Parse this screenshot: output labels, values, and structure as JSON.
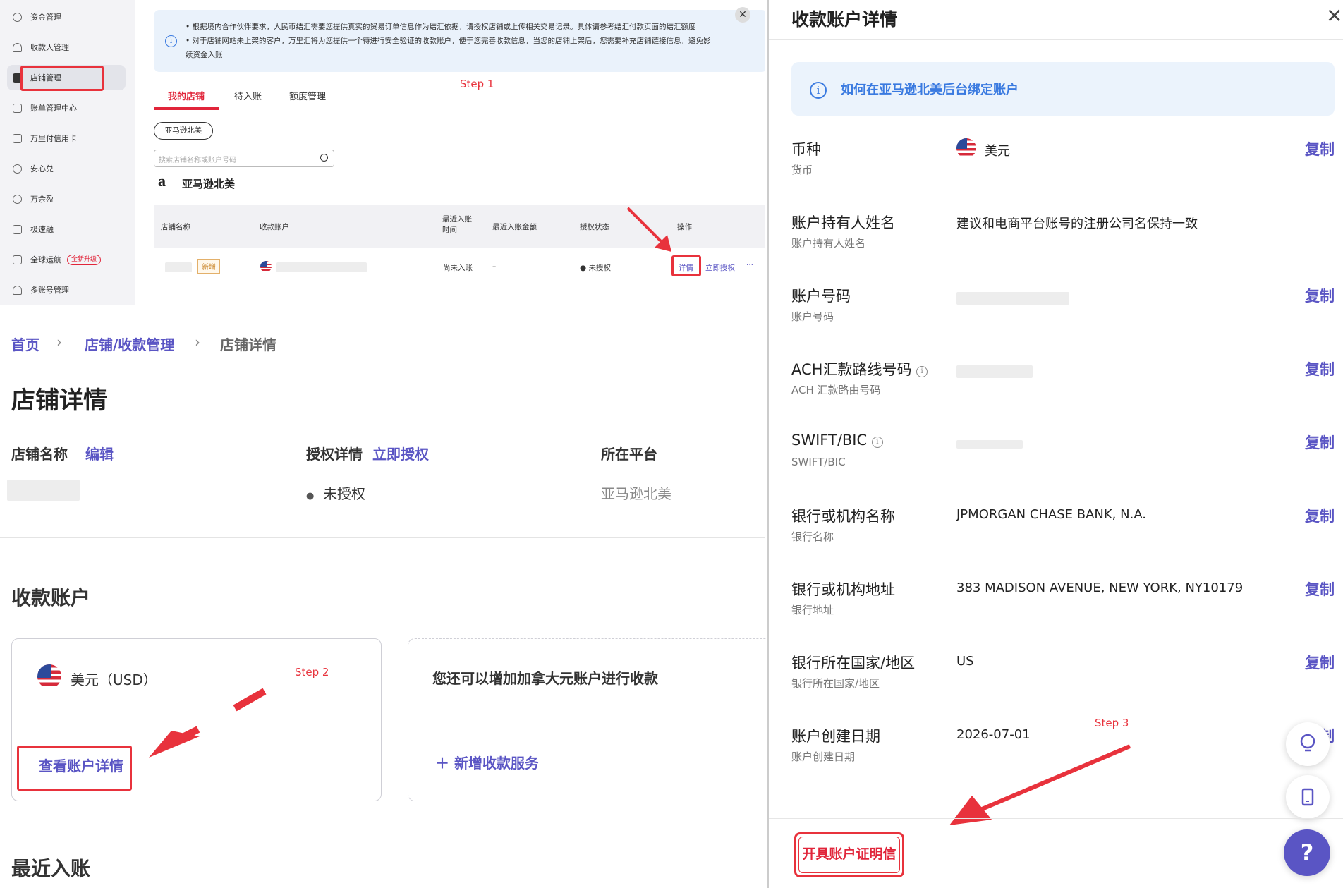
{
  "sidebar": {
    "items": [
      {
        "label": "资金管理",
        "icon": "fund-icon"
      },
      {
        "label": "收款人管理",
        "icon": "payee-icon"
      },
      {
        "label": "店铺管理",
        "icon": "store-icon"
      },
      {
        "label": "账单管理中心",
        "icon": "bill-icon"
      },
      {
        "label": "万里付信用卡",
        "icon": "card-icon"
      },
      {
        "label": "安心兑",
        "icon": "exchange-icon"
      },
      {
        "label": "万余盈",
        "icon": "yield-icon"
      },
      {
        "label": "极速融",
        "icon": "finance-icon"
      },
      {
        "label": "全球运航",
        "icon": "shipping-icon"
      },
      {
        "label": "多账号管理",
        "icon": "accounts-icon"
      }
    ],
    "upgrade_badge": "全新升级"
  },
  "notice": {
    "line1": "• 根据境内合作伙伴要求，人民币结汇需要您提供真实的贸易订单信息作为结汇依据，请授权店铺或上传相关交易记录。具体请参考结汇付款页面的结汇额度",
    "line2": "• 对于店铺网站未上架的客户，万里汇将为您提供一个待进行安全验证的收款账户，便于您完善收款信息，当您的店铺上架后，您需要补充店铺链接信息，避免影",
    "line3": "续资金入账"
  },
  "tabs": [
    "我的店铺",
    "待入账",
    "额度管理"
  ],
  "steps": {
    "step1": "Step 1",
    "step2": "Step 2",
    "step3": "Step 3"
  },
  "filter_pill": "亚马逊北美",
  "search_placeholder": "搜索店铺名称或账户号码",
  "platform_title": "亚马逊北美",
  "table": {
    "headers": [
      "店铺名称",
      "收款账户",
      "最近入账时间",
      "最近入账金额",
      "授权状态",
      "操作"
    ],
    "row": {
      "new_badge": "新增",
      "last_time": "尚未入账",
      "last_amount": "–",
      "auth_status": "未授权",
      "detail": "详情",
      "authorize": "立即授权",
      "more": "···"
    }
  },
  "breadcrumb": [
    "首页",
    "店铺/收款管理",
    "店铺详情"
  ],
  "store_detail": {
    "title": "店铺详情",
    "name_label": "店铺名称",
    "edit": "编辑",
    "auth_label": "授权详情",
    "auth_link": "立即授权",
    "auth_value": "未授权",
    "platform_label": "所在平台",
    "platform_value": "亚马逊北美",
    "receive_title": "收款账户",
    "usd_card": "美元（USD）",
    "view_detail": "查看账户详情",
    "add_text": "您还可以增加加拿大元账户进行收款",
    "add_service": "新增收款服务",
    "recent_title": "最近入账"
  },
  "account_panel": {
    "title": "收款账户详情",
    "hint": "如何在亚马逊北美后台绑定账户",
    "copy": "复制",
    "rows": [
      {
        "label": "币种",
        "sub": "货币",
        "value": "美元"
      },
      {
        "label": "账户持有人姓名",
        "sub": "账户持有人姓名",
        "value": "建议和电商平台账号的注册公司名保持一致"
      },
      {
        "label": "账户号码",
        "sub": "账户号码",
        "value": ""
      },
      {
        "label": "ACH汇款路线号码",
        "sub": "ACH 汇款路由号码",
        "value": ""
      },
      {
        "label": "SWIFT/BIC",
        "sub": "SWIFT/BIC",
        "value": ""
      },
      {
        "label": "银行或机构名称",
        "sub": "银行名称",
        "value": "JPMORGAN CHASE BANK, N.A."
      },
      {
        "label": "银行或机构地址",
        "sub": "银行地址",
        "value": "383 MADISON AVENUE, NEW YORK, NY10179"
      },
      {
        "label": "银行所在国家/地区",
        "sub": "银行所在国家/地区",
        "value": "US"
      },
      {
        "label": "账户创建日期",
        "sub": "账户创建日期",
        "value": "2026-07-01"
      }
    ],
    "issue_letter": "开具账户证明信",
    "help": "?"
  },
  "colors": {
    "accent": "#5a55c4",
    "red": "#e8323c",
    "brand_red": "#e1253a"
  }
}
